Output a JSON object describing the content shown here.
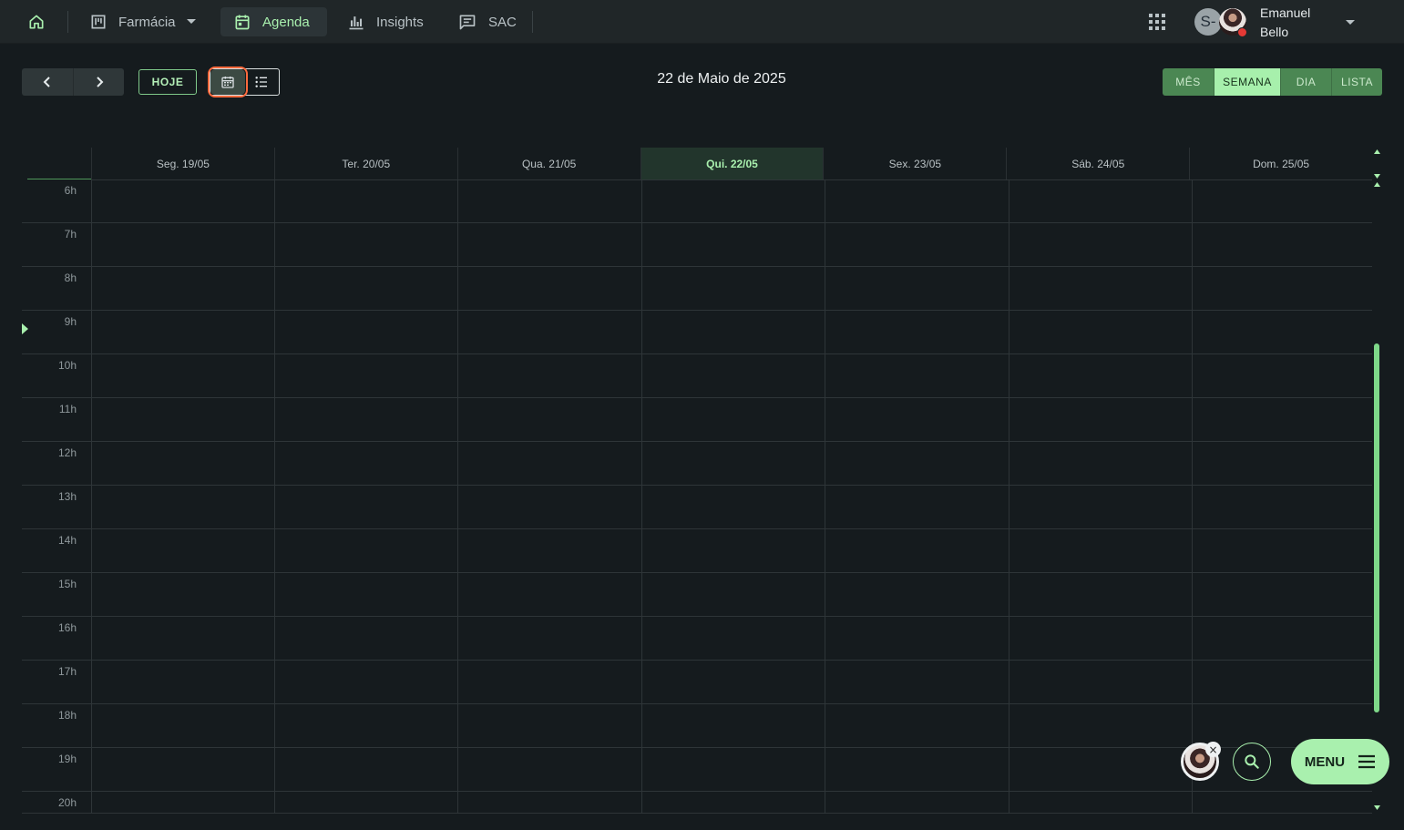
{
  "navbar": {
    "pharmacy_label": "Farmácia",
    "agenda_label": "Agenda",
    "insights_label": "Insights",
    "sac_label": "SAC",
    "avatar_initial": "S-",
    "user_first": "Emanuel",
    "user_last": "Bello"
  },
  "toolbar": {
    "today_label": "HOJE",
    "current_date": "22 de Maio de 2025",
    "views": [
      "MÊS",
      "SEMANA",
      "DIA",
      "LISTA"
    ],
    "active_view": "SEMANA"
  },
  "calendar": {
    "days": [
      "Seg. 19/05",
      "Ter. 20/05",
      "Qua. 21/05",
      "Qui. 22/05",
      "Sex. 23/05",
      "Sáb. 24/05",
      "Dom. 25/05"
    ],
    "today_day": "Qui. 22/05",
    "hours": [
      "6h",
      "7h",
      "8h",
      "9h",
      "10h",
      "11h",
      "12h",
      "13h",
      "14h",
      "15h",
      "16h",
      "17h",
      "18h",
      "19h",
      "20h"
    ]
  },
  "fab": {
    "close_symbol": "×",
    "menu_label": "MENU"
  },
  "colors": {
    "accent": "#a9f0ae",
    "background": "#151b1e",
    "navbar": "#202628",
    "view_button": "#4b8753",
    "status_offline": "#e53935",
    "focus_outline": "#ff6a3d"
  }
}
